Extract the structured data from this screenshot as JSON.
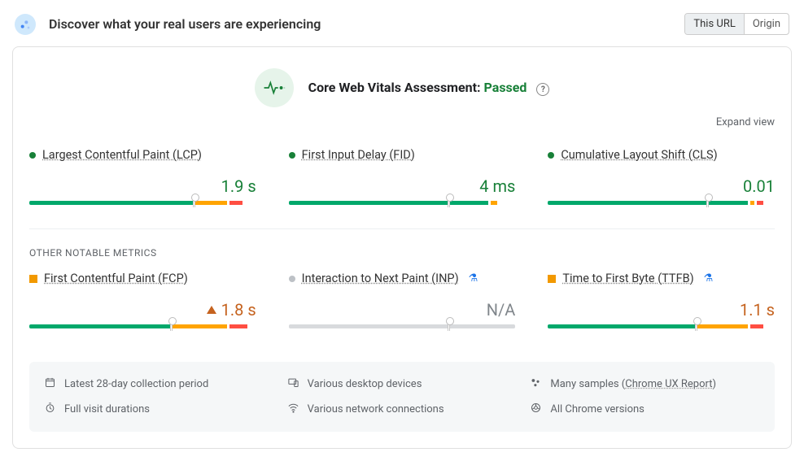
{
  "header": {
    "title": "Discover what your real users are experiencing",
    "seg_url": "This URL",
    "seg_origin": "Origin"
  },
  "assessment": {
    "label_prefix": "Core Web Vitals Assessment:",
    "result": "Passed"
  },
  "expand": "Expand view",
  "core_metrics": [
    {
      "name": "Largest Contentful Paint (LCP)",
      "value": "1.9 s",
      "status": "green",
      "bar": {
        "g": 72,
        "o": 14,
        "r": 6
      },
      "marker": 72
    },
    {
      "name": "First Input Delay (FID)",
      "value": "4 ms",
      "status": "green",
      "bar": {
        "g": 88,
        "o": 3,
        "r": 0
      },
      "marker": 70
    },
    {
      "name": "Cumulative Layout Shift (CLS)",
      "value": "0.01",
      "status": "green",
      "bar": {
        "g": 88,
        "o": 2,
        "r": 3
      },
      "marker": 70
    }
  ],
  "other_title": "OTHER NOTABLE METRICS",
  "other_metrics": [
    {
      "name": "First Contentful Paint (FCP)",
      "value": "1.8 s",
      "status": "orange",
      "shape": "sq",
      "warn": true,
      "experimental": false,
      "bar": {
        "g": 62,
        "o": 24,
        "r": 8
      },
      "marker": 62,
      "gray": false
    },
    {
      "name": "Interaction to Next Paint (INP)",
      "value": "N/A",
      "status": "gray",
      "shape": "dot",
      "warn": false,
      "experimental": true,
      "bar": {},
      "marker": 70,
      "gray": true
    },
    {
      "name": "Time to First Byte (TTFB)",
      "value": "1.1 s",
      "status": "orange",
      "shape": "sq",
      "warn": false,
      "experimental": true,
      "bar": {
        "g": 65,
        "o": 22,
        "r": 6
      },
      "marker": 65,
      "gray": false
    }
  ],
  "footer": {
    "col1": [
      {
        "icon": "calendar",
        "text": "Latest 28-day collection period"
      },
      {
        "icon": "timer",
        "text": "Full visit durations"
      }
    ],
    "col2": [
      {
        "icon": "desktop",
        "text": "Various desktop devices"
      },
      {
        "icon": "network",
        "text": "Various network connections"
      }
    ],
    "col3": [
      {
        "icon": "samples",
        "text": "Many samples",
        "link": "Chrome UX Report"
      },
      {
        "icon": "chrome",
        "text": "All Chrome versions"
      }
    ]
  }
}
